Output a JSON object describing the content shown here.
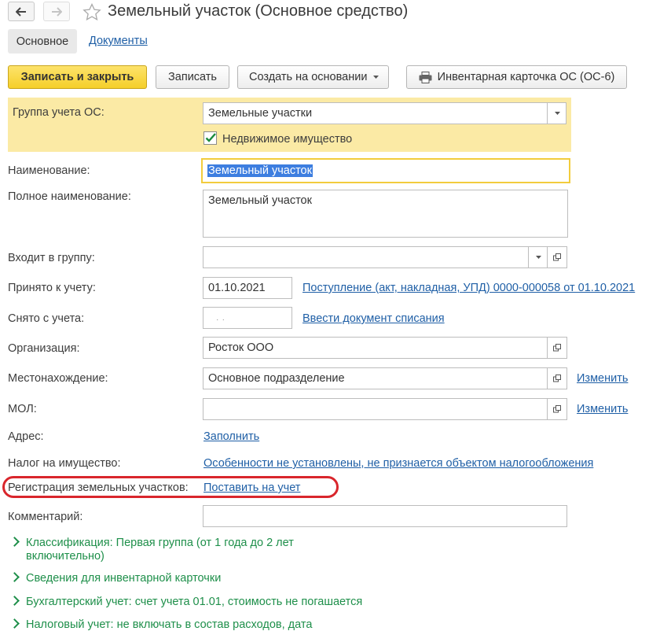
{
  "window": {
    "title": "Земельный участок (Основное средство)"
  },
  "tabs": [
    {
      "label": "Основное"
    },
    {
      "label": "Документы"
    }
  ],
  "toolbar": {
    "save_close": "Записать и закрыть",
    "save": "Записать",
    "create_based": "Создать на основании",
    "inventory_card": "Инвентарная карточка ОС (ОС-6)"
  },
  "form": {
    "group": {
      "label": "Группа учета ОС:",
      "value": "Земельные участки"
    },
    "real_estate": {
      "label": "Недвижимое имущество",
      "checked": true
    },
    "name": {
      "label": "Наименование:",
      "value": "Земельный участок"
    },
    "full_name": {
      "label": "Полное наименование:",
      "value": "Земельный участок"
    },
    "parent_group": {
      "label": "Входит в группу:",
      "value": ""
    },
    "accepted": {
      "label": "Принято к учету:",
      "value": "01.10.2021",
      "link": "Поступление (акт, накладная, УПД) 0000-000058 от 01.10.2021"
    },
    "removed": {
      "label": "Снято с учета:",
      "value": " .  .",
      "link": "Ввести документ списания"
    },
    "organization": {
      "label": "Организация:",
      "value": "Росток ООО"
    },
    "location": {
      "label": "Местонахождение:",
      "value": "Основное подразделение",
      "link": "Изменить"
    },
    "mol": {
      "label": "МОЛ:",
      "value": "",
      "link": "Изменить"
    },
    "address": {
      "label": "Адрес:",
      "link": "Заполнить"
    },
    "property_tax": {
      "label": "Налог на имущество:",
      "link": "Особенности не установлены, не признается объектом налогообложения"
    },
    "land_registration": {
      "label": "Регистрация земельных участков:",
      "link": "Поставить на учет"
    },
    "comment": {
      "label": "Комментарий:",
      "value": ""
    }
  },
  "sections": [
    {
      "line1": "Классификация: Первая группа (от 1 года до 2 лет",
      "line2": "включительно)"
    },
    {
      "line1": "Сведения для инвентарной карточки"
    },
    {
      "line1": "Бухгалтерский учет: счет учета 01.01, стоимость не погашается"
    },
    {
      "line1": "Налоговый учет: не включать в состав расходов, дата"
    }
  ],
  "colors": {
    "primary_button": "#f5cf2a",
    "highlight_panel": "#fbeaa5",
    "link": "#1f5fa6",
    "section_green": "#1e8f4a",
    "annotation_red": "#d9262c"
  }
}
